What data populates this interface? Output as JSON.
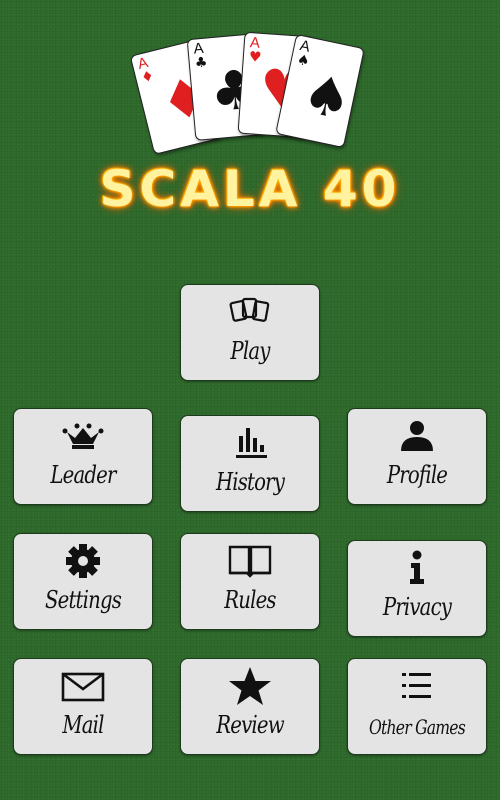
{
  "title": "SCALA 40",
  "logo_cards": [
    {
      "rank": "A",
      "suit": "♦",
      "color": "red"
    },
    {
      "rank": "A",
      "suit": "♣",
      "color": "black"
    },
    {
      "rank": "A",
      "suit": "♥",
      "color": "red"
    },
    {
      "rank": "A",
      "suit": "♠",
      "color": "black"
    }
  ],
  "menu": {
    "play": {
      "label": "Play",
      "icon": "cards-icon"
    },
    "leader": {
      "label": "Leader",
      "icon": "crown-icon"
    },
    "history": {
      "label": "History",
      "icon": "bar-chart-icon"
    },
    "profile": {
      "label": "Profile",
      "icon": "user-icon"
    },
    "settings": {
      "label": "Settings",
      "icon": "gear-icon"
    },
    "rules": {
      "label": "Rules",
      "icon": "book-icon"
    },
    "privacy": {
      "label": "Privacy",
      "icon": "info-icon"
    },
    "mail": {
      "label": "Mail",
      "icon": "mail-icon"
    },
    "review": {
      "label": "Review",
      "icon": "star-icon"
    },
    "other_games": {
      "label": "Other Games",
      "icon": "list-icon"
    }
  },
  "colors": {
    "felt": "#2f6b2c",
    "button": "#e4e4e4",
    "title_glow": "#ff7a00"
  }
}
